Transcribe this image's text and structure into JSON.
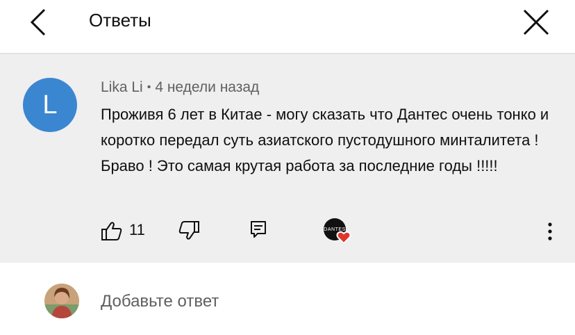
{
  "header": {
    "title": "Ответы"
  },
  "comment": {
    "avatar_letter": "L",
    "author": "Lika Li",
    "separator": "•",
    "time": "4 недели назад",
    "text": "Проживя 6 лет в Китае - могу сказать что Дантес очень тонко и коротко передал суть азиатского пустодушного минталитета ! Браво ! Это самая крутая работа за последние годы !!!!!",
    "likes": "11",
    "creator_badge": "DANTES"
  },
  "reply": {
    "placeholder": "Добавьте ответ"
  },
  "colors": {
    "avatar_bg": "#3b86d1",
    "comment_bg": "#efefef",
    "heart": "#e0362c"
  }
}
